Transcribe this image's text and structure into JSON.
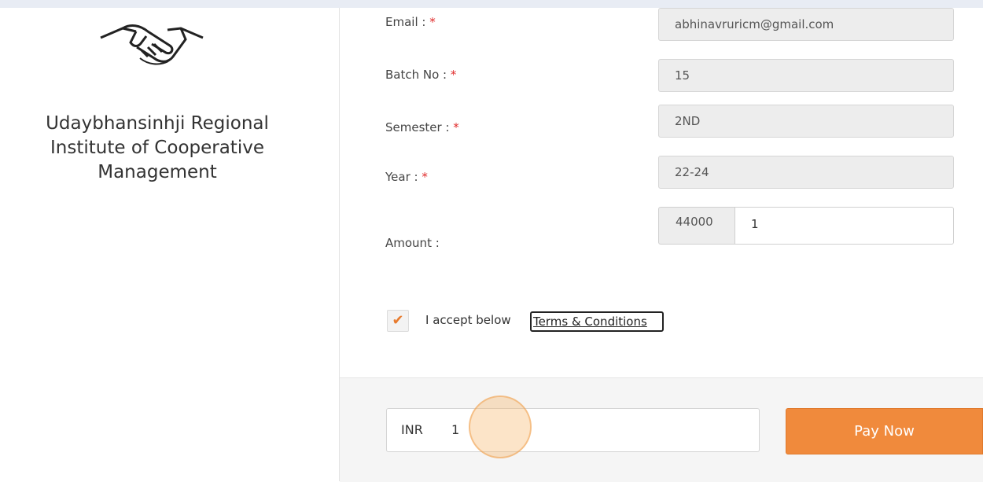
{
  "institute": {
    "name_line1": "Udaybhansinhji Regional",
    "name_line2": "Institute of Cooperative",
    "name_line3": "Management",
    "logo_icon": "handshake-icon"
  },
  "form": {
    "required_mark": "*",
    "email": {
      "label": "Email :",
      "value": "abhinavruricm@gmail.com"
    },
    "batch": {
      "label": "Batch No :",
      "value": "15"
    },
    "semester": {
      "label": "Semester :",
      "value": "2ND"
    },
    "year": {
      "label": "Year :",
      "value": "22-24"
    },
    "amount": {
      "label": "Amount :",
      "fixed": "44000",
      "value": "1"
    },
    "terms": {
      "checked": true,
      "text": "I accept below",
      "link": "Terms & Conditions"
    }
  },
  "payment": {
    "currency": "INR",
    "value": "1",
    "button": "Pay Now",
    "accent_color": "#f08a3c"
  }
}
